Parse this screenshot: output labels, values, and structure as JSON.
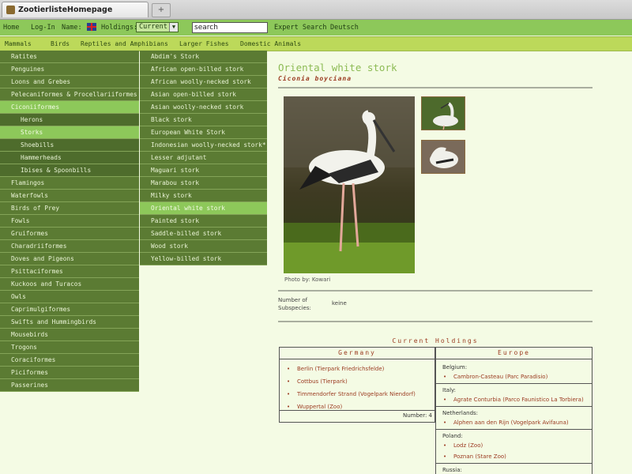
{
  "browser": {
    "tab_title": "ZootierlisteHomepage",
    "new_tab_symbol": "+"
  },
  "topbar": {
    "home": "Home",
    "login": "Log-In",
    "name": "Name:",
    "holdings": "Holdings:",
    "holdings_value": "Current",
    "search_value": "search",
    "expert_search": "Expert Search",
    "language": "Deutsch"
  },
  "categories": [
    "Mammals",
    "Birds",
    "Reptiles and Amphibians",
    "Larger Fishes",
    "Domestic Animals"
  ],
  "orders": [
    {
      "label": "Ratites"
    },
    {
      "label": "Penguines"
    },
    {
      "label": "Loons and Grebes"
    },
    {
      "label": "Pelecaniformes & Procellariiformes"
    },
    {
      "label": "Ciconiiformes",
      "selected": true
    },
    {
      "label": "Herons",
      "sub": true
    },
    {
      "label": "Storks",
      "sub": true,
      "selected": true
    },
    {
      "label": "Shoebills",
      "sub": true
    },
    {
      "label": "Hammerheads",
      "sub": true
    },
    {
      "label": "Ibises & Spoonbills",
      "sub": true
    },
    {
      "label": "Flamingos"
    },
    {
      "label": "Waterfowls"
    },
    {
      "label": "Birds of Prey"
    },
    {
      "label": "Fowls"
    },
    {
      "label": "Gruiformes"
    },
    {
      "label": "Charadriiformes"
    },
    {
      "label": "Doves and Pigeons"
    },
    {
      "label": "Psittaciformes"
    },
    {
      "label": "Kuckoos and Turacos"
    },
    {
      "label": "Owls"
    },
    {
      "label": "Caprimulgiformes"
    },
    {
      "label": "Swifts and Hummingbirds"
    },
    {
      "label": "Mousebirds"
    },
    {
      "label": "Trogons"
    },
    {
      "label": "Coraciformes"
    },
    {
      "label": "Piciformes"
    },
    {
      "label": "Passerines"
    }
  ],
  "species": [
    {
      "label": "Abdim's Stork"
    },
    {
      "label": "African open-billed stork"
    },
    {
      "label": "African woolly-necked stork"
    },
    {
      "label": "Asian open-billed stork"
    },
    {
      "label": "Asian woolly-necked stork"
    },
    {
      "label": "Black stork"
    },
    {
      "label": "European White Stork"
    },
    {
      "label": "Indonesian woolly-necked stork*"
    },
    {
      "label": "Lesser adjutant"
    },
    {
      "label": "Maguari stork"
    },
    {
      "label": "Marabou stork"
    },
    {
      "label": "Milky stork"
    },
    {
      "label": "Oriental white stork",
      "selected": true
    },
    {
      "label": "Painted stork"
    },
    {
      "label": "Saddle-billed stork"
    },
    {
      "label": "Wood stork"
    },
    {
      "label": "Yellow-billed stork"
    }
  ],
  "content": {
    "title": "Oriental white stork",
    "scientific": "Ciconia boyciana",
    "photo_credit": "Photo by: Kowari",
    "subspecies_label_1": "Number of",
    "subspecies_label_2": "Subspecies:",
    "subspecies_value": "keine",
    "holdings_title": "Current Holdings",
    "germany_header": "Germany",
    "germany": [
      "Berlin (Tierpark Friedrichsfelde)",
      "Cottbus (Tierpark)",
      "Timmendorfer Strand (Vogelpark Niendorf)",
      "Wuppertal (Zoo)"
    ],
    "germany_number": "Number: 4",
    "europe_header": "Europe",
    "europe": [
      {
        "country": "Belgium:",
        "zoos": [
          "Cambron-Casteau (Parc Paradisio)"
        ]
      },
      {
        "country": "Italy:",
        "zoos": [
          "Agrate Conturbia (Parco Faunistico La Torbiera)"
        ]
      },
      {
        "country": "Netherlands:",
        "zoos": [
          "Alphen aan den Rijn (Vogelpark Avifauna)"
        ]
      },
      {
        "country": "Poland:",
        "zoos": [
          "Lodz (Zoo)",
          "Poznan (Stare Zoo)"
        ]
      },
      {
        "country": "Russia:",
        "zoos": []
      }
    ]
  }
}
